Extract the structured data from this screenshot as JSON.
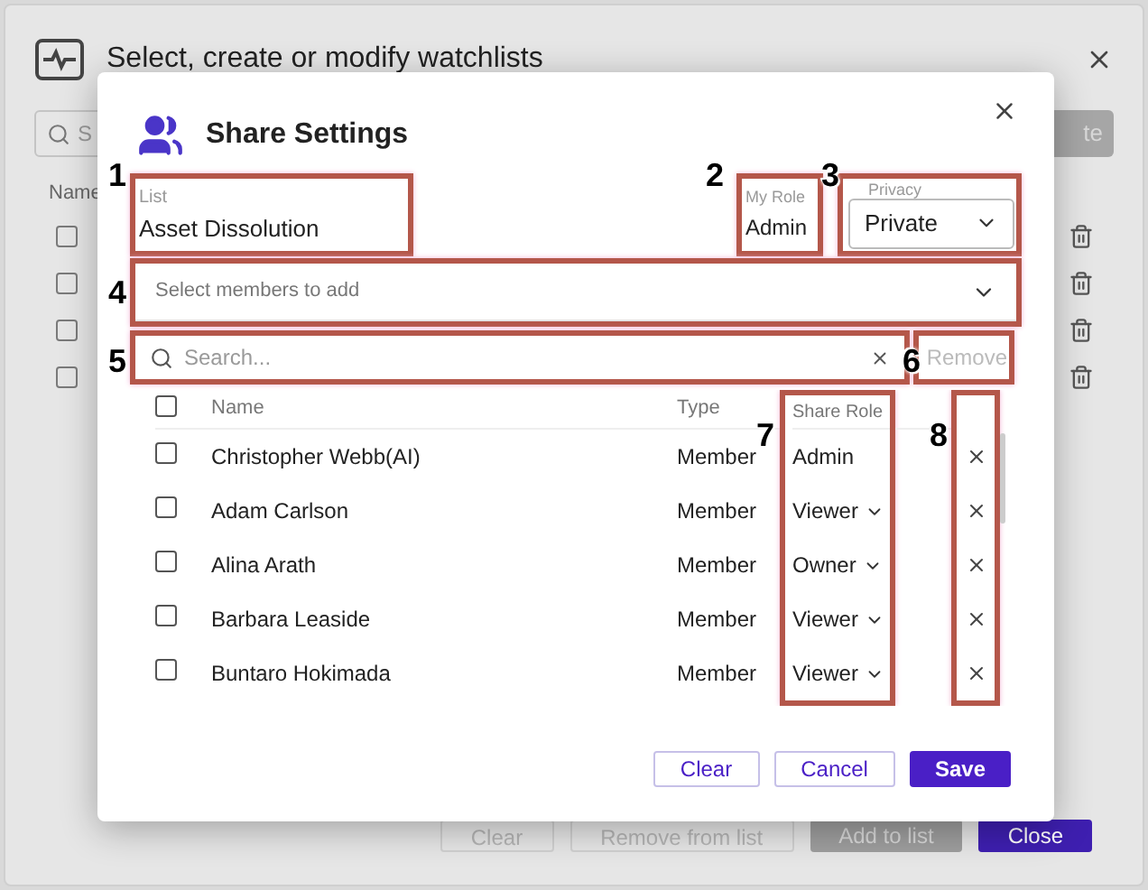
{
  "background": {
    "title": "Select, create or modify watchlists",
    "search_placeholder": "S",
    "create_button": "te",
    "column": "Name",
    "rows": [
      {
        "checked": false
      },
      {
        "checked": false
      },
      {
        "checked": false
      },
      {
        "checked": false
      }
    ],
    "buttons": [
      {
        "label": "Clear",
        "kind": "outline",
        "disabled": true
      },
      {
        "label": "Remove from list",
        "kind": "outline",
        "disabled": true
      },
      {
        "label": "Add to list",
        "kind": "filled",
        "disabled": true
      },
      {
        "label": "Close",
        "kind": "filled",
        "disabled": false
      }
    ]
  },
  "dialog": {
    "title": "Share Settings",
    "list": {
      "label": "List",
      "value": "Asset Dissolution"
    },
    "my_role": {
      "label": "My Role",
      "value": "Admin"
    },
    "privacy": {
      "label": "Privacy",
      "value": "Private"
    },
    "members": {
      "placeholder": "Select members to add"
    },
    "search": {
      "placeholder": "Search..."
    },
    "remove_button": {
      "label": "Remove",
      "disabled": true
    },
    "table": {
      "columns": [
        "Name",
        "Type",
        "Share Role"
      ],
      "all_checked": false,
      "rows": [
        {
          "name": "Christopher Webb(AI)",
          "type": "Member",
          "role": "Admin",
          "editable": false,
          "checked": false
        },
        {
          "name": "Adam Carlson",
          "type": "Member",
          "role": "Viewer",
          "editable": true,
          "checked": false
        },
        {
          "name": "Alina Arath",
          "type": "Member",
          "role": "Owner",
          "editable": true,
          "checked": false
        },
        {
          "name": "Barbara Leaside",
          "type": "Member",
          "role": "Viewer",
          "editable": true,
          "checked": false
        },
        {
          "name": "Buntaro Hokimada",
          "type": "Member",
          "role": "Viewer",
          "editable": true,
          "checked": false
        }
      ]
    },
    "buttons": [
      {
        "label": "Clear",
        "kind": "outline"
      },
      {
        "label": "Cancel",
        "kind": "outline"
      },
      {
        "label": "Save",
        "kind": "primary"
      }
    ]
  },
  "annotations": [
    {
      "label": "1"
    },
    {
      "label": "2"
    },
    {
      "label": "3"
    },
    {
      "label": "4"
    },
    {
      "label": "5"
    },
    {
      "label": "6"
    },
    {
      "label": "7"
    },
    {
      "label": "8"
    }
  ]
}
